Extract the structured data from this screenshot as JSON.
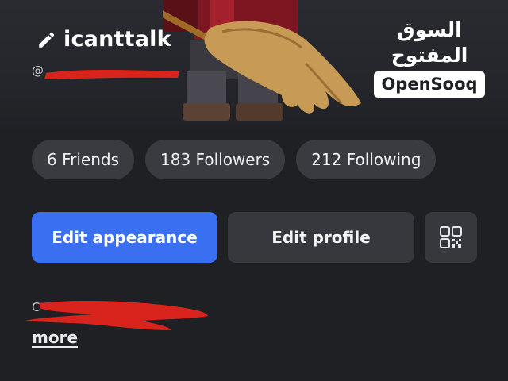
{
  "watermark": {
    "arabic": "السوق المفتوح",
    "brand": "OpenSooq"
  },
  "profile": {
    "username": "icanttalk",
    "handle_prefix": "@",
    "bio_prefix": "C"
  },
  "stats": [
    {
      "label": "6 Friends"
    },
    {
      "label": "183 Followers"
    },
    {
      "label": "212 Following"
    }
  ],
  "actions": {
    "edit_appearance": "Edit appearance",
    "edit_profile": "Edit profile"
  },
  "more_label": "more",
  "colors": {
    "background": "#1f2024",
    "pill": "#393b41",
    "primary_button": "#3a6ff2",
    "secondary_button": "#36383e",
    "redaction": "#d8241c"
  },
  "icons": {
    "edit": "pencil-icon",
    "qr": "qr-code-icon"
  }
}
